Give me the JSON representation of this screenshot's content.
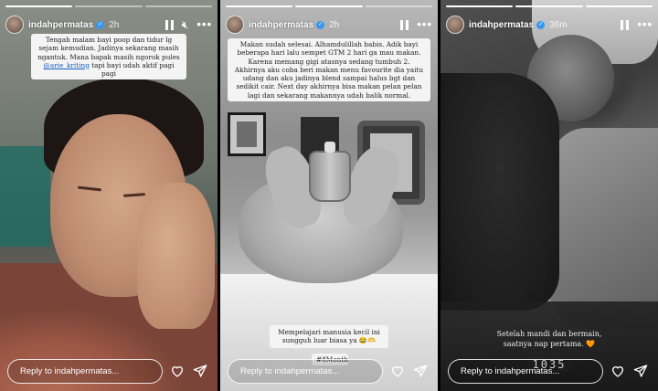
{
  "stories": [
    {
      "username": "indahpermatas",
      "time": "2h",
      "caption_parts": [
        "Tengah malam bayi poop dan tidur lg sejam kemudian. Jadinya sekarang masih ngantuk. Mana bapak masih ngorok pules ",
        "@arie_kriting",
        " tapi bayi udah aktif pagi pagi"
      ],
      "reply_placeholder": "Reply to indahpermatas...",
      "progress": [
        "done",
        "current",
        "todo"
      ]
    },
    {
      "username": "indahpermatas",
      "time": "2h",
      "caption": "Makan sudah selesai. Alhamdulillah babis. Adik bayi beberapa hari lalu sempet GTM 2 hari ga mau makan. Karena memang gigi atasnya sedang tumbuh 2. Akhirnya aku coba beri makan menu favourite dia yaitu udang dan aku jadinya blend sampai halus bgt dan sedikit cair. Next day akhirnya bisa makan pelan pelan lagi dan sekarang makannya udah balik normal.",
      "overlay_text": "Mempelajari manusia kecil ini sungguh luar biasa ya 😂🫶",
      "hashtag": "#8Month",
      "reply_placeholder": "Reply to indahpermatas..."
    },
    {
      "username": "indahpermatas",
      "time": "36m",
      "caption_line1": "Setelah mandi dan bermain,",
      "caption_line2": "saatnya nap pertama. 🧡",
      "clock": "1035",
      "reply_placeholder": "Reply to indahpermatas..."
    }
  ],
  "icons": {
    "pause": "pause-icon",
    "mute": "mute-icon",
    "more": "more-options-icon",
    "like": "heart-icon",
    "share": "send-icon",
    "verified": "verified-badge-icon"
  }
}
